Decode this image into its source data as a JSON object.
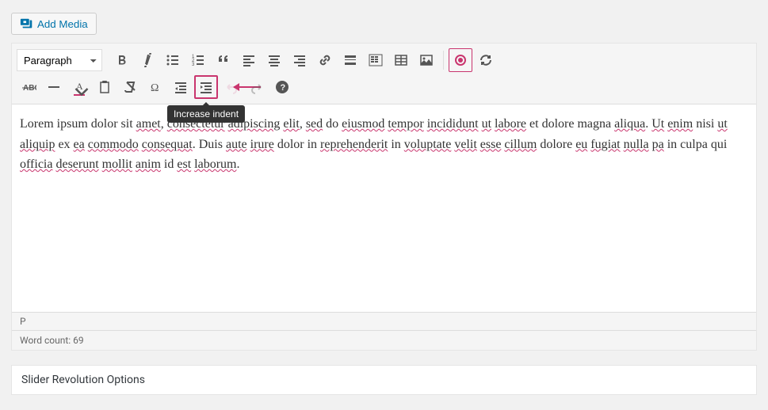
{
  "buttons": {
    "add_media": "Add Media"
  },
  "toolbar": {
    "format_select": "Paragraph",
    "tooltip_increase_indent": "Increase indent"
  },
  "content": {
    "text": "Lorem ipsum dolor sit amet, consectetur adipiscing elit, sed do eiusmod tempor incididunt ut labore et dolore magna aliqua. Ut enim nisi ut aliquip ex ea commodo consequat. Duis aute irure dolor in reprehenderit in voluptate velit esse cillum dolore eu fugiat nulla pa in culpa qui officia deserunt mollit anim id est laborum."
  },
  "status": {
    "element_path": "P",
    "word_count_label": "Word count: 69"
  },
  "panel": {
    "slider_revolution": "Slider Revolution Options"
  }
}
